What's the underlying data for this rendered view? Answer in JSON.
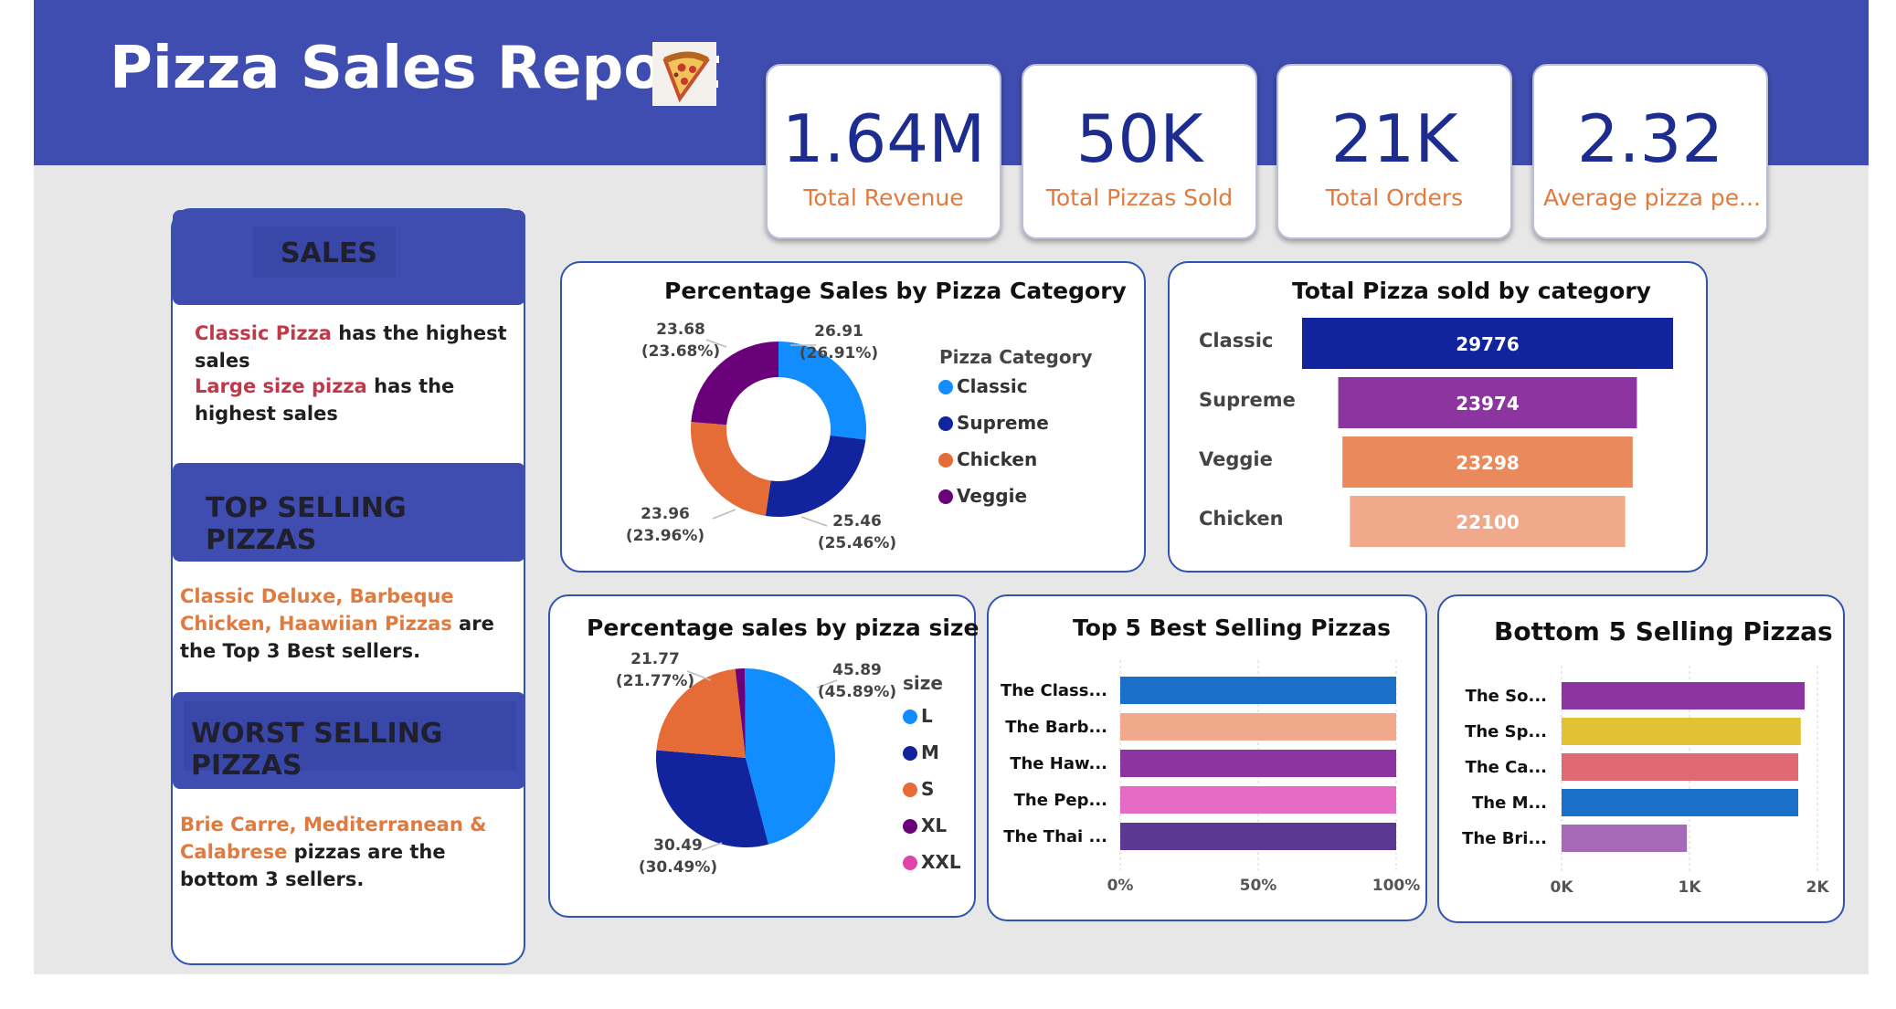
{
  "header": {
    "title": "Pizza Sales Report",
    "icon": "pizza-slice-icon"
  },
  "kpis": [
    {
      "value": "1.64M",
      "label": "Total Revenue"
    },
    {
      "value": "50K",
      "label": "Total Pizzas Sold"
    },
    {
      "value": "21K",
      "label": "Total Orders"
    },
    {
      "value": "2.32",
      "label": "Average pizza pe..."
    }
  ],
  "sidebar": {
    "sales_heading": "SALES",
    "sales_1_highlight": "Classic Pizza",
    "sales_1_rest": " has the highest sales",
    "sales_2_highlight": "Large size pizza",
    "sales_2_rest": " has the highest sales",
    "top_heading": "TOP SELLING PIZZAS",
    "top_highlight": "Classic Deluxe, Barbeque Chicken, Haawiian Pizzas",
    "top_rest": " are the Top 3 Best sellers.",
    "worst_heading": "WORST SELLING PIZZAS",
    "worst_highlight": "Brie Carre, Mediterranean & Calabrese",
    "worst_rest": " pizzas are the bottom 3 sellers."
  },
  "colors": {
    "banner": "#3f4db1",
    "kpi_value": "#1d2d8f",
    "kpi_label": "#e07a3f",
    "classic": "#118dff",
    "supreme": "#12239e",
    "chicken": "#e66c37",
    "veggie": "#6b007b",
    "xxl": "#e044a7"
  },
  "chart_data": [
    {
      "type": "donut",
      "title": "Percentage Sales by Pizza Category",
      "legend_title": "Pizza Category",
      "legend_position": "right",
      "slices": [
        {
          "name": "Classic",
          "value": 26.91,
          "label_value": "26.91",
          "label_pct": "(26.91%)",
          "color": "#118dff"
        },
        {
          "name": "Supreme",
          "value": 25.46,
          "label_value": "25.46",
          "label_pct": "(25.46%)",
          "color": "#12239e"
        },
        {
          "name": "Chicken",
          "value": 23.96,
          "label_value": "23.96",
          "label_pct": "(23.96%)",
          "color": "#e66c37"
        },
        {
          "name": "Veggie",
          "value": 23.68,
          "label_value": "23.68",
          "label_pct": "(23.68%)",
          "color": "#6b007b"
        }
      ]
    },
    {
      "type": "bar",
      "subtype": "funnel",
      "title": "Total Pizza sold by category",
      "categories": [
        "Classic",
        "Supreme",
        "Veggie",
        "Chicken"
      ],
      "values": [
        29776,
        23974,
        23298,
        22100
      ],
      "colors": [
        "#12239e",
        "#8c34a0",
        "#e9895c",
        "#f0a98a"
      ]
    },
    {
      "type": "pie",
      "title": "Percentage sales by pizza size",
      "legend_title": "size",
      "legend_position": "right",
      "slices": [
        {
          "name": "L",
          "value": 45.89,
          "label_value": "45.89",
          "label_pct": "(45.89%)",
          "color": "#118dff"
        },
        {
          "name": "M",
          "value": 30.49,
          "label_value": "30.49",
          "label_pct": "(30.49%)",
          "color": "#12239e"
        },
        {
          "name": "S",
          "value": 21.77,
          "label_value": "21.77",
          "label_pct": "(21.77%)",
          "color": "#e66c37"
        },
        {
          "name": "XL",
          "value": 1.72,
          "color": "#6b007b"
        },
        {
          "name": "XXL",
          "value": 0.12,
          "color": "#e044a7"
        }
      ]
    },
    {
      "type": "bar",
      "orientation": "horizontal",
      "title": "Top 5 Best Selling Pizzas",
      "categories": [
        "The Class...",
        "The Barb...",
        "The Haw...",
        "The Pep...",
        "The Thai ..."
      ],
      "values": [
        100,
        100,
        100,
        100,
        100
      ],
      "colors": [
        "#1a6fc8",
        "#f0a98a",
        "#8c34a0",
        "#e66bc4",
        "#5b3891"
      ],
      "ticks": [
        "0%",
        "50%",
        "100%"
      ],
      "xlim": [
        0,
        100
      ],
      "grid": true
    },
    {
      "type": "bar",
      "orientation": "horizontal",
      "title": "Bottom 5 Selling Pizzas",
      "categories": [
        "The So...",
        "The Sp...",
        "The Ca...",
        "The M...",
        "The Bri..."
      ],
      "values": [
        1900,
        1870,
        1850,
        1850,
        980
      ],
      "colors": [
        "#8c34a0",
        "#e2c234",
        "#e06a73",
        "#1a6fc8",
        "#a569b8"
      ],
      "ticks": [
        "0K",
        "1K",
        "2K"
      ],
      "xlim": [
        0,
        2000
      ],
      "grid": true
    }
  ]
}
